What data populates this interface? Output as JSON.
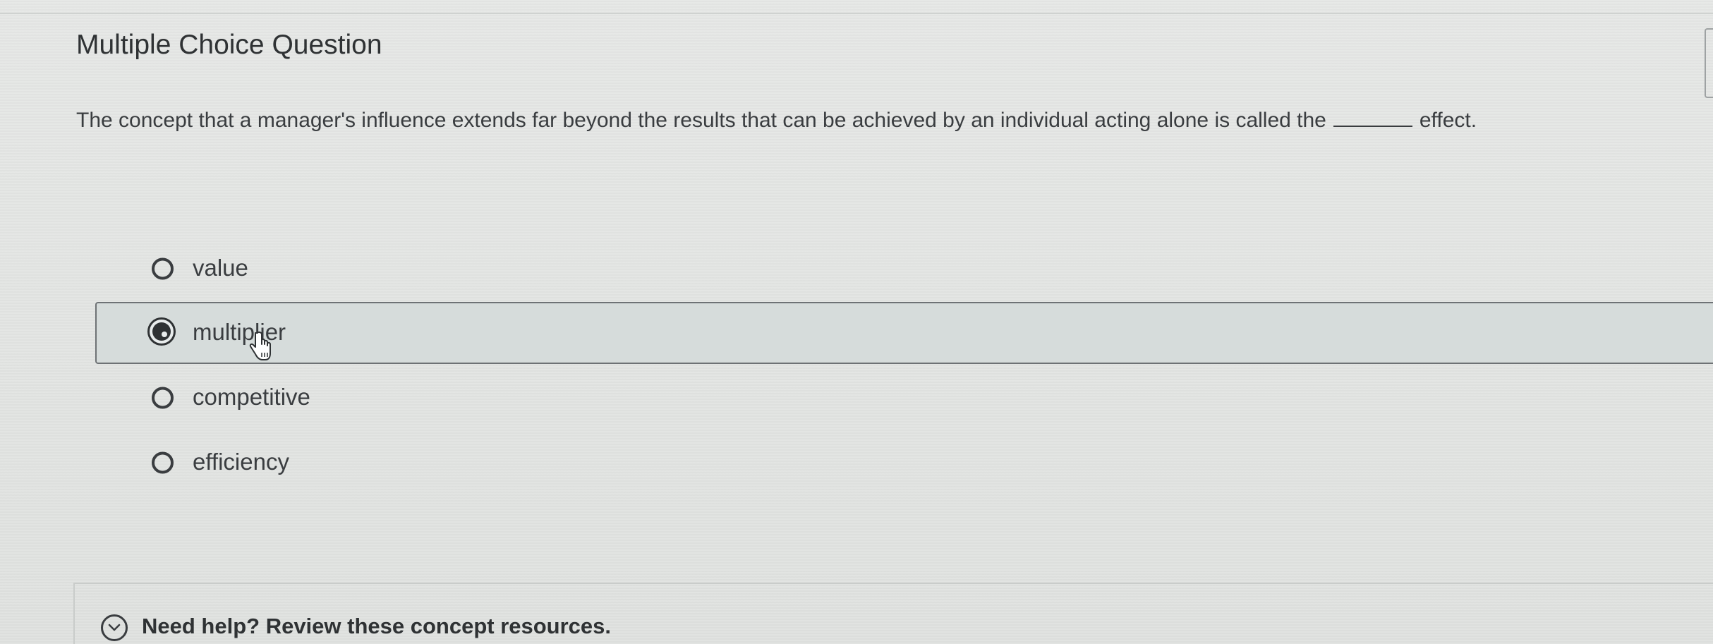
{
  "question": {
    "title": "Multiple Choice Question",
    "text_before_blank": "The concept that a manager's influence extends far beyond the results that can be achieved by an individual acting alone is called the",
    "text_after_blank": "effect."
  },
  "options": [
    {
      "label": "value",
      "selected": false
    },
    {
      "label": "multiplier",
      "selected": true
    },
    {
      "label": "competitive",
      "selected": false
    },
    {
      "label": "efficiency",
      "selected": false
    }
  ],
  "help": {
    "label": "Need help? Review these concept resources.",
    "icon": "chevron-down-circle-icon"
  }
}
